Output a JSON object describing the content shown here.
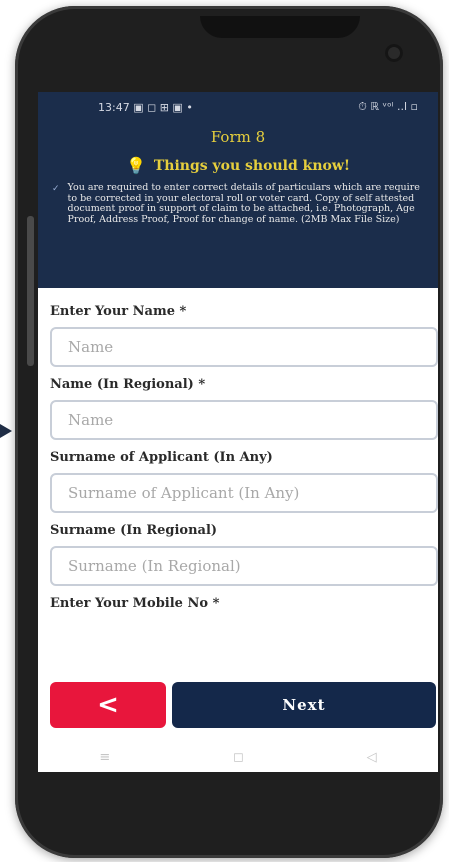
{
  "status_bar": {
    "time": "13:47",
    "left_icons": "▣ ◻ ⊞ ▣ •",
    "right_icons": "⏱ ℝ ᵛᵒˡ ..l ▫"
  },
  "header": {
    "form_title": "Form 8",
    "things_title": "Things you should know!",
    "bulb_icon": "lightbulb-icon",
    "notice": "You are required to enter correct details of particulars which are require to be corrected in your electoral roll or voter card. Copy of self attested document proof in support of claim to be attached, i.e. Photograph, Age Proof, Address Proof, Proof for change of name. (2MB Max File Size)"
  },
  "form": {
    "name_label": "Enter Your Name *",
    "name_placeholder": "Name",
    "regional_name_label": "Name (In Regional) *",
    "regional_name_placeholder": "Name",
    "surname_label": "Surname of Applicant (In Any)",
    "surname_placeholder": "Surname of Applicant (In Any)",
    "surname_regional_label": "Surname (In Regional)",
    "surname_regional_placeholder": "Surname (In Regional)",
    "mobile_label": "Enter Your Mobile No *"
  },
  "buttons": {
    "back_label": "<",
    "next_label": "Next"
  },
  "nav": {
    "recent": "≡",
    "home": "◻",
    "back": "◁"
  },
  "colors": {
    "header_bg": "#1b2d4b",
    "accent_yellow": "#e6cf3d",
    "back_red": "#e8163c",
    "next_navy": "#14284a"
  }
}
